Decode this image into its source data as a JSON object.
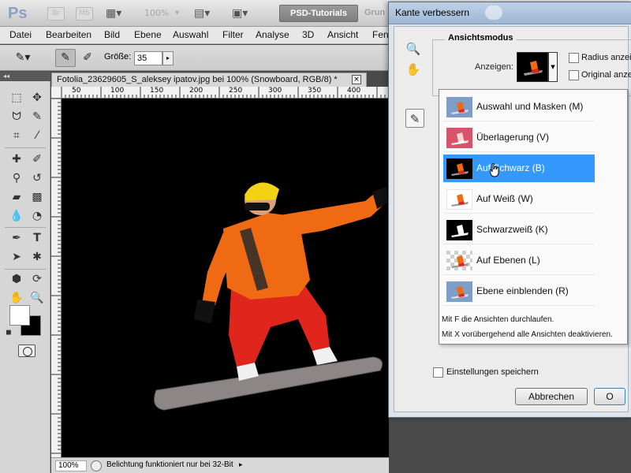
{
  "app": {
    "logo": "Ps",
    "topbar_icons": [
      "Br",
      "Mb"
    ],
    "zoom": "100%",
    "workspace_button": "PSD-Tutorials",
    "workspace_extra": "Grun"
  },
  "menubar": {
    "items": [
      "Datei",
      "Bearbeiten",
      "Bild",
      "Ebene",
      "Auswahl",
      "Filter",
      "Analyse",
      "3D",
      "Ansicht",
      "Fen"
    ]
  },
  "options": {
    "size_label": "Größe:",
    "size_value": "35"
  },
  "document": {
    "tab_title": "Fotolia_23629605_S_aleksey ipatov.jpg bei 100% (Snowboard, RGB/8) *",
    "close": "×",
    "ruler_top": [
      "50",
      "100",
      "150",
      "200",
      "250",
      "300",
      "350",
      "400"
    ],
    "status_zoom": "100%",
    "status_text": "Belichtung funktioniert nur bei 32-Bit"
  },
  "dialog": {
    "title": "Kante verbessern",
    "group_label": "Ansichtsmodus",
    "show_label": "Anzeigen:",
    "radius_label": "Radius anzeige",
    "original_label": "Original anzeig",
    "views": [
      {
        "label": "Auswahl und Masken (M)",
        "thumb": "sky"
      },
      {
        "label": "Überlagerung (V)",
        "thumb": "red"
      },
      {
        "label": "Auf Schwarz (B)",
        "thumb": "black",
        "selected": true
      },
      {
        "label": "Auf Weiß (W)",
        "thumb": "white"
      },
      {
        "label": "Schwarzweiß (K)",
        "thumb": "bw"
      },
      {
        "label": "Auf Ebenen (L)",
        "thumb": "checker"
      },
      {
        "label": "Ebene einblenden (R)",
        "thumb": "sky"
      }
    ],
    "hint_f": "Mit F die Ansichten durchlaufen.",
    "hint_x": "Mit X vorübergehend alle Ansichten deaktivieren.",
    "save_settings": "Einstellungen speichern",
    "cancel": "Abbrechen",
    "ok": "O"
  }
}
